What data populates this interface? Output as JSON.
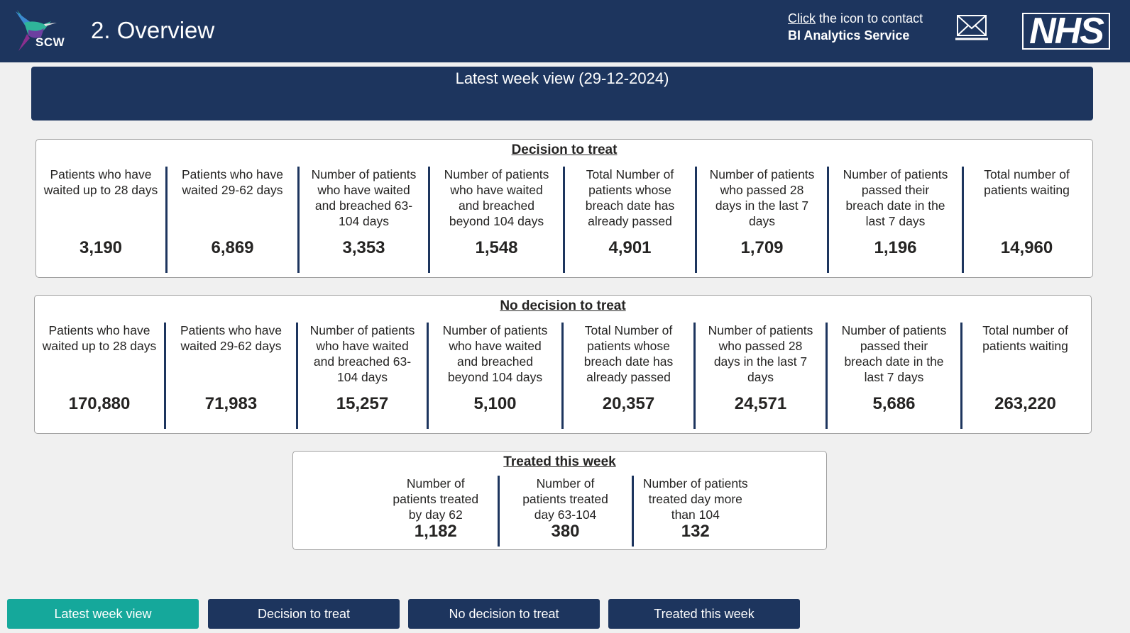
{
  "header": {
    "logo_text": "SCW",
    "title": "2. Overview",
    "contact_click": "Click",
    "contact_rest": " the icon to contact",
    "contact_service": "BI Analytics Service",
    "mail_icon": "envelope-icon",
    "nhs_logo": "NHS",
    "bg_color": "#1d355e"
  },
  "banner": {
    "title": "Latest week view (29-12-2024)"
  },
  "decision": {
    "title": "Decision to treat",
    "columns": [
      {
        "label": "Patients who have waited up to 28 days",
        "value": "3,190"
      },
      {
        "label": "Patients who have waited 29-62 days",
        "value": "6,869"
      },
      {
        "label": "Number of patients who have waited and breached 63-104 days",
        "value": "3,353"
      },
      {
        "label": "Number of patients who have waited and breached beyond 104 days",
        "value": "1,548"
      },
      {
        "label": "Total Number of patients whose breach date has already passed",
        "value": "4,901"
      },
      {
        "label": "Number of patients who passed 28 days in the last 7 days",
        "value": "1,709"
      },
      {
        "label": "Number of patients passed their breach date in the last 7 days",
        "value": "1,196"
      },
      {
        "label": "Total number of patients waiting",
        "value": "14,960"
      }
    ]
  },
  "no_decision": {
    "title": "No decision to treat",
    "columns": [
      {
        "label": "Patients who have waited up to 28 days",
        "value": "170,880"
      },
      {
        "label": "Patients who have waited 29-62 days",
        "value": "71,983"
      },
      {
        "label": "Number of patients who have waited and breached 63-104 days",
        "value": "15,257"
      },
      {
        "label": "Number of patients who have waited and breached beyond 104 days",
        "value": "5,100"
      },
      {
        "label": "Total Number of patients whose breach date has already passed",
        "value": "20,357"
      },
      {
        "label": "Number of patients who passed 28 days in the last 7 days",
        "value": "24,571"
      },
      {
        "label": "Number of patients passed their breach date in the last 7 days",
        "value": "5,686"
      },
      {
        "label": "Total number of patients waiting",
        "value": "263,220"
      }
    ]
  },
  "treated": {
    "title": "Treated this week",
    "columns": [
      {
        "label": "Number of patients treated by day 62",
        "value": "1,182"
      },
      {
        "label": "Number of patients treated day 63-104",
        "value": "380"
      },
      {
        "label": "Number of patients treated day more than 104",
        "value": "132"
      }
    ]
  },
  "nav": {
    "buttons": [
      {
        "label": "Latest week view",
        "active": true
      },
      {
        "label": "Decision to treat",
        "active": false
      },
      {
        "label": "No decision to treat",
        "active": false
      },
      {
        "label": "Treated this week",
        "active": false
      }
    ],
    "active_color": "#15a89b",
    "inactive_color": "#1d355e"
  }
}
